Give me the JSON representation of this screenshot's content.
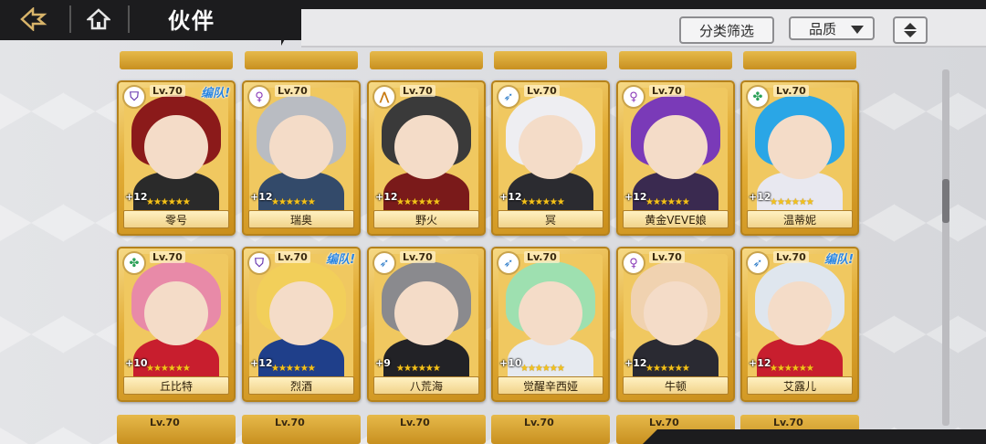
{
  "header": {
    "title": "伙伴",
    "back_icon": "back-arrow-icon",
    "home_icon": "home-icon",
    "filter_label": "分类筛选",
    "quality_label": "品质",
    "sort_icon": "sort-updown-icon"
  },
  "colors": {
    "topbar": "#1c1c1e",
    "card_gold": "#e2ac35",
    "team_text": "#2c86e0",
    "star": "#f3c21a"
  },
  "cards": [
    {
      "name": "零号",
      "level": "Lv.70",
      "plus": "+12",
      "team": "编队!",
      "class_icon": "shield-icon",
      "stars": "★★★★★★",
      "hair": "#8b1a1a",
      "outfit": "#2a2a2a"
    },
    {
      "name": "瑞奥",
      "level": "Lv.70",
      "plus": "+12",
      "team": "",
      "class_icon": "orb-icon",
      "stars": "★★★★★★",
      "hair": "#b9bcc2",
      "outfit": "#334a6a"
    },
    {
      "name": "野火",
      "level": "Lv.70",
      "plus": "+12",
      "team": "",
      "class_icon": "flame-icon",
      "stars": "★★★★★★",
      "hair": "#3a3a3a",
      "outfit": "#7a1a1a"
    },
    {
      "name": "冥",
      "level": "Lv.70",
      "plus": "+12",
      "team": "",
      "class_icon": "bow-icon",
      "stars": "★★★★★★",
      "hair": "#eeeef2",
      "outfit": "#2b2b30"
    },
    {
      "name": "黄金VEVE娘",
      "level": "Lv.70",
      "plus": "+12",
      "team": "",
      "class_icon": "orb-icon",
      "stars": "★★★★★★",
      "hair": "#7a3ab8",
      "outfit": "#3a2a50"
    },
    {
      "name": "温蒂妮",
      "level": "Lv.70",
      "plus": "+12",
      "team": "",
      "class_icon": "cross-icon",
      "stars": "★★★★★★",
      "hair": "#2aa6e6",
      "outfit": "#e8e8f0"
    },
    {
      "name": "丘比特",
      "level": "Lv.70",
      "plus": "+10",
      "team": "",
      "class_icon": "cross-icon",
      "stars": "★★★★★★",
      "hair": "#e88aa8",
      "outfit": "#c81e2e"
    },
    {
      "name": "烈酒",
      "level": "Lv.70",
      "plus": "+12",
      "team": "编队!",
      "class_icon": "shield-icon",
      "stars": "★★★★★★",
      "hair": "#f2cf5a",
      "outfit": "#1f3f8a"
    },
    {
      "name": "八荒海",
      "level": "Lv.70",
      "plus": "+9",
      "team": "",
      "class_icon": "bow-icon",
      "stars": "★★★★★★",
      "hair": "#8a8a8e",
      "outfit": "#222226"
    },
    {
      "name": "觉醒辛西娅",
      "level": "Lv.70",
      "plus": "+10",
      "team": "",
      "class_icon": "bow-icon",
      "stars": "★★★★★★",
      "hair": "#9ee0b0",
      "outfit": "#e6eaf0"
    },
    {
      "name": "牛顿",
      "level": "Lv.70",
      "plus": "+12",
      "team": "",
      "class_icon": "orb-icon",
      "stars": "★★★★★★",
      "hair": "#f0d2b0",
      "outfit": "#2a2a32"
    },
    {
      "name": "艾露儿",
      "level": "Lv.70",
      "plus": "+12",
      "team": "编队!",
      "class_icon": "bow-icon",
      "stars": "★★★★★★",
      "hair": "#dfe6ee",
      "outfit": "#c81e2e"
    }
  ],
  "partial_top_count": 6,
  "partial_bottom_levels": [
    "Lv.70",
    "Lv.70",
    "Lv.70",
    "Lv.70",
    "Lv.70",
    "Lv.70"
  ]
}
